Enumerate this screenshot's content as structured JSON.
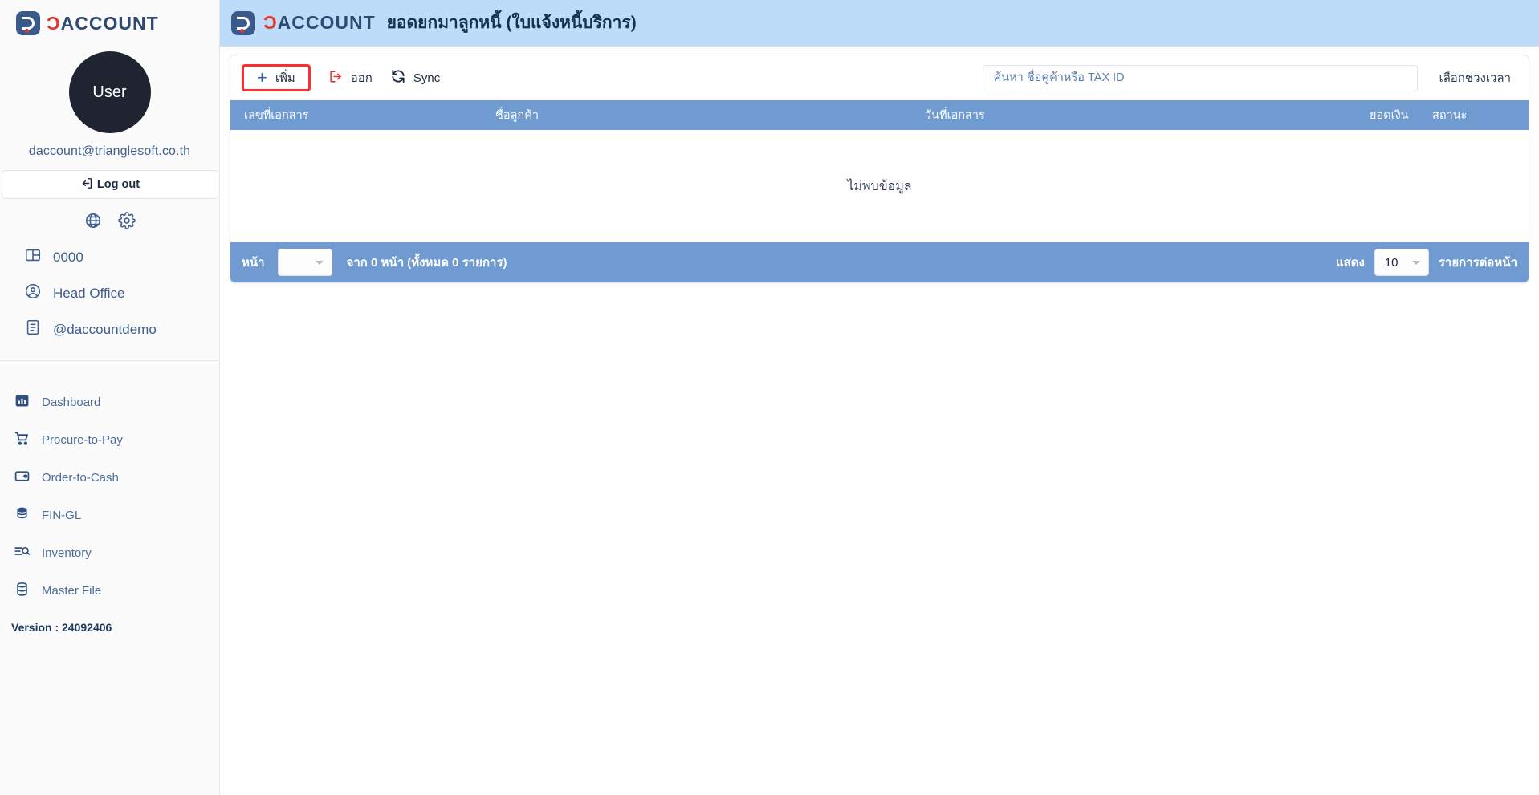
{
  "brand": {
    "name_red": "Ɔ",
    "name_navy": "ACCOUNT",
    "mark_label": "daccount-logo-mark"
  },
  "sidebar": {
    "avatar_label": "User",
    "user_email": "daccount@trianglesoft.co.th",
    "logout_label": "Log out",
    "quick_icons": [
      {
        "name": "globe-icon",
        "label": "Language"
      },
      {
        "name": "gear-icon",
        "label": "Settings"
      }
    ],
    "org_items": [
      {
        "icon": "company-icon",
        "label": "0000"
      },
      {
        "icon": "user-circle-icon",
        "label": "Head Office"
      },
      {
        "icon": "document-icon",
        "label": "@daccountdemo"
      }
    ],
    "nav_items": [
      {
        "icon": "bar-chart-icon",
        "label": "Dashboard"
      },
      {
        "icon": "shopping-cart-icon",
        "label": "Procure-to-Pay"
      },
      {
        "icon": "wallet-icon",
        "label": "Order-to-Cash"
      },
      {
        "icon": "coins-icon",
        "label": "FIN-GL"
      },
      {
        "icon": "inventory-icon",
        "label": "Inventory"
      },
      {
        "icon": "database-icon",
        "label": "Master File"
      }
    ],
    "version_label": "Version : 24092406"
  },
  "header": {
    "title": "ยอดยกมาลูกหนี้ (ใบแจ้งหนี้บริการ)"
  },
  "toolbar": {
    "add_label": "เพิ่ม",
    "export_label": "ออก",
    "sync_label": "Sync",
    "search_placeholder": "ค้นหา ชื่อคู่ค้าหรือ TAX ID",
    "search_value": "",
    "date_range_label": "เลือกช่วงเวลา"
  },
  "table": {
    "columns": [
      "เลขที่เอกสาร",
      "ชื่อลูกค้า",
      "วันที่เอกสาร",
      "ยอดเงิน",
      "สถานะ"
    ],
    "rows": [],
    "empty_message": "ไม่พบข้อมูล"
  },
  "footer": {
    "page_label": "หน้า",
    "page_value": "",
    "of_pages_text": "จาก 0 หน้า (ทั้งหมด 0 รายการ)",
    "show_label": "แสดง",
    "rows_per_page_value": "10",
    "rows_per_page_label": "รายการต่อหน้า"
  },
  "colors": {
    "topbar_bg": "#bcdcfa",
    "table_header_bg": "#6f9bd1",
    "accent_red": "#e8352e",
    "highlight_red": "#ff2d2d",
    "navy": "#2e4a72"
  }
}
